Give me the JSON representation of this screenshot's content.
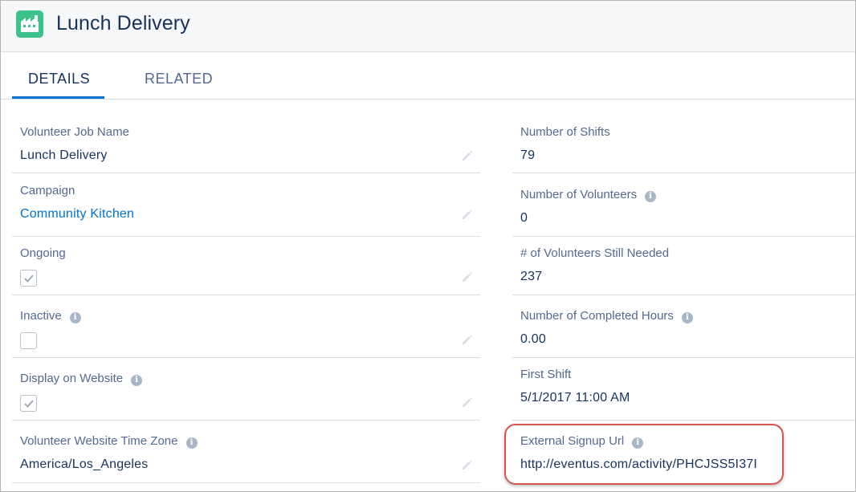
{
  "header": {
    "title": "Lunch Delivery",
    "app_icon": "factory-icon"
  },
  "tabs": [
    {
      "label": "DETAILS",
      "active": true
    },
    {
      "label": "RELATED",
      "active": false
    }
  ],
  "left_fields": {
    "job_name": {
      "label": "Volunteer Job Name",
      "value": "Lunch Delivery"
    },
    "campaign": {
      "label": "Campaign",
      "value": "Community Kitchen"
    },
    "ongoing": {
      "label": "Ongoing",
      "checked": true
    },
    "inactive": {
      "label": "Inactive",
      "checked": false
    },
    "display_website": {
      "label": "Display on Website",
      "checked": true
    },
    "time_zone": {
      "label": "Volunteer Website Time Zone",
      "value": "America/Los_Angeles"
    }
  },
  "right_fields": {
    "num_shifts": {
      "label": "Number of Shifts",
      "value": "79"
    },
    "num_volunteers": {
      "label": "Number of Volunteers",
      "value": "0"
    },
    "still_needed": {
      "label": "# of Volunteers Still Needed",
      "value": "237"
    },
    "completed_hours": {
      "label": "Number of Completed Hours",
      "value": "0.00"
    },
    "first_shift": {
      "label": "First Shift",
      "value": "5/1/2017 11:00 AM"
    },
    "signup_url": {
      "label": "External Signup Url",
      "value": "http://eventus.com/activity/PHCJSS5I37I"
    }
  },
  "colors": {
    "accent": "#0070d2",
    "app_icon": "#3ec28b",
    "highlight": "#d9534f"
  }
}
